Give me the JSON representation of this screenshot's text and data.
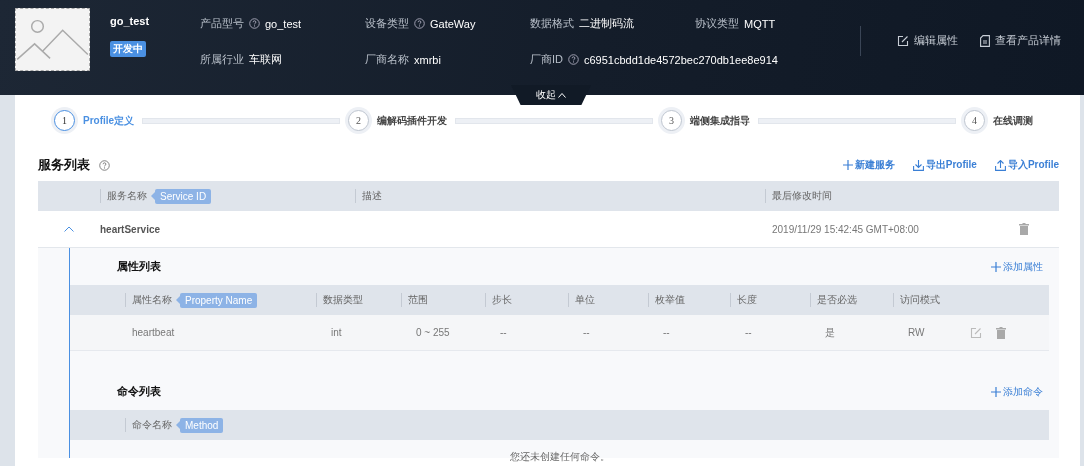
{
  "product": {
    "name": "go_test",
    "status": "开发中",
    "field_rows": [
      [
        {
          "label": "产品型号",
          "help": true,
          "value": "go_test"
        },
        {
          "label": "设备类型",
          "help": true,
          "value": "GateWay"
        },
        {
          "label": "数据格式",
          "help": false,
          "value": "二进制码流"
        },
        {
          "label": "协议类型",
          "help": false,
          "value": "MQTT"
        }
      ],
      [
        {
          "label": "所属行业",
          "help": false,
          "value": "车联网"
        },
        {
          "label": "厂商名称",
          "help": false,
          "value": "xmrbi"
        },
        {
          "label": "厂商ID",
          "help": true,
          "value": "c6951cbdd1de4572bec270db1ee8e914"
        }
      ]
    ],
    "actions": [
      {
        "label": "编辑属性",
        "kind": "edit"
      },
      {
        "label": "查看产品详情",
        "kind": "document"
      }
    ]
  },
  "collapse": {
    "label": "收起"
  },
  "steps": [
    {
      "number": "1",
      "label": "Profile定义",
      "selected": true
    },
    {
      "number": "2",
      "label": "编解码插件开发",
      "selected": false
    },
    {
      "number": "3",
      "label": "端侧集成指导",
      "selected": false
    },
    {
      "number": "4",
      "label": "在线调测",
      "selected": false
    }
  ],
  "services": {
    "title": "服务列表",
    "actions": [
      {
        "label": "新建服务",
        "kind": "add"
      },
      {
        "label": "导出Profile",
        "kind": "download"
      },
      {
        "label": "导入Profile",
        "kind": "upload"
      }
    ],
    "columns": [
      {
        "label": "服务名称",
        "tag": "Service ID"
      },
      {
        "label": "描述"
      },
      {
        "label": "最后修改时间"
      }
    ],
    "rows": [
      {
        "name": "heartService",
        "time": "2019/11/29 15:42:45 GMT+08:00",
        "expanded": true,
        "properties": {
          "title": "属性列表",
          "add": "添加属性",
          "columns": [
            {
              "label": "属性名称",
              "tag": "Property Name"
            },
            {
              "label": "数据类型"
            },
            {
              "label": "范围"
            },
            {
              "label": "步长"
            },
            {
              "label": "单位"
            },
            {
              "label": "枚举值"
            },
            {
              "label": "长度"
            },
            {
              "label": "是否必选"
            },
            {
              "label": "访问模式"
            }
          ],
          "rows": [
            {
              "cells": [
                "heartbeat",
                "int",
                "0 ~ 255",
                "--",
                "--",
                "--",
                "--",
                "是",
                "RW"
              ]
            }
          ]
        },
        "commands": {
          "title": "命令列表",
          "add": "添加命令",
          "columns": [
            {
              "label": "命令名称",
              "tag": "Method"
            }
          ],
          "empty": "您还未创建任何命令。"
        }
      }
    ]
  }
}
